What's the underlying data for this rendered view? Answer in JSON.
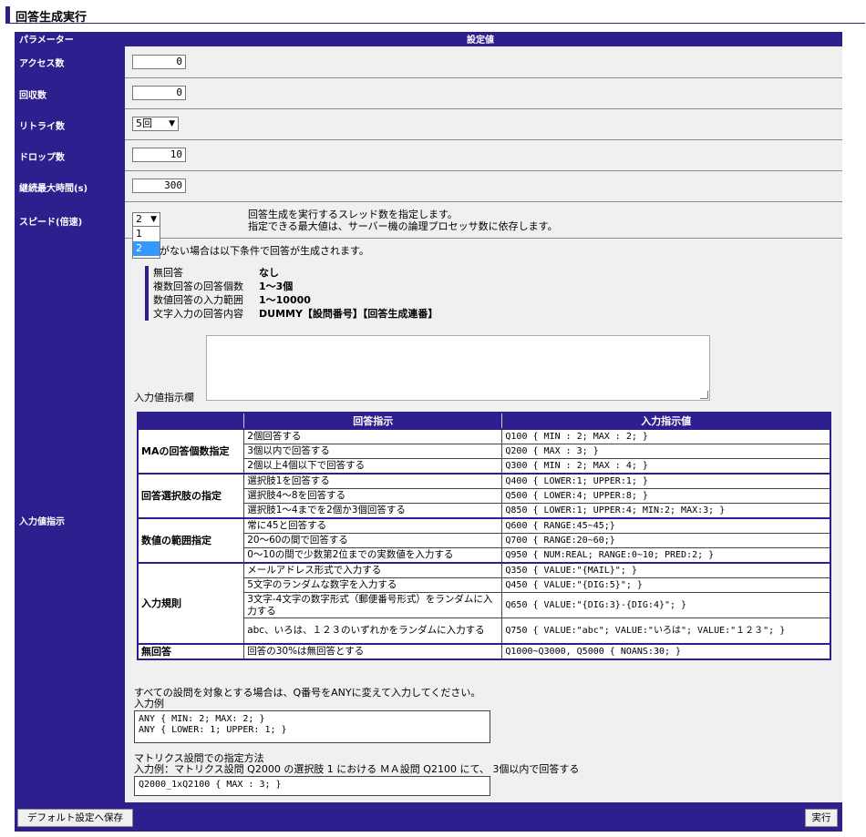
{
  "page_title": "回答生成実行",
  "header": {
    "param": "パラメーター",
    "value": "設定値"
  },
  "rows": {
    "access": {
      "label": "アクセス数",
      "value": "0"
    },
    "collect": {
      "label": "回収数",
      "value": "0"
    },
    "retry": {
      "label": "リトライ数",
      "value": "5回"
    },
    "drop": {
      "label": "ドロップ数",
      "value": "10"
    },
    "duration": {
      "label": "継続最大時間(s)",
      "value": "300"
    },
    "speed": {
      "label": "スピード(倍速)",
      "value": "2",
      "options": [
        "1",
        "2"
      ],
      "hint1": "回答生成を実行するスレッド数を指定します。",
      "hint2": "指定できる最大値は、サーバー機の論理プロセッサ数に依存します。"
    },
    "input": {
      "label": "入力値指示",
      "intro": "がない場合は以下条件で回答が生成されます。",
      "conditions": [
        {
          "k": "無回答",
          "v": "なし"
        },
        {
          "k": "複数回答の回答個数",
          "v": "1～3個"
        },
        {
          "k": "数値回答の入力範囲",
          "v": "1～10000"
        },
        {
          "k": "文字入力の回答内容",
          "v": "DUMMY【設問番号】【回答生成連番】"
        }
      ],
      "textarea_label": "入力値指示欄",
      "table": {
        "headers": [
          "",
          "回答指示",
          "入力指示値"
        ],
        "groups": [
          {
            "cat": "MAの回答個数指定",
            "rows": [
              [
                "2個回答する",
                "Q100 { MIN : 2; MAX : 2; }"
              ],
              [
                "3個以内で回答する",
                "Q200 { MAX : 3; }"
              ],
              [
                "2個以上4個以下で回答する",
                "Q300 { MIN : 2; MAX : 4; }"
              ]
            ]
          },
          {
            "cat": "回答選択肢の指定",
            "rows": [
              [
                "選択肢1を回答する",
                "Q400 { LOWER:1; UPPER:1; }"
              ],
              [
                "選択肢4～8を回答する",
                "Q500 { LOWER:4; UPPER:8; }"
              ],
              [
                "選択肢1～4までを2個か3個回答する",
                "Q850 { LOWER:1; UPPER:4; MIN:2; MAX:3; }"
              ]
            ]
          },
          {
            "cat": "数値の範囲指定",
            "rows": [
              [
                "常に45と回答する",
                "Q600 { RANGE:45~45;}"
              ],
              [
                "20～60の間で回答する",
                "Q700 { RANGE:20~60;}"
              ],
              [
                "0～10の間で少数第2位までの実数値を入力する",
                "Q950 { NUM:REAL; RANGE:0~10; PRED:2; }"
              ]
            ]
          },
          {
            "cat": "入力規則",
            "rows": [
              [
                "メールアドレス形式で入力する",
                "Q350 { VALUE:\"{MAIL}\"; }"
              ],
              [
                "5文字のランダムな数字を入力する",
                "Q450 { VALUE:\"{DIG:5}\"; }"
              ],
              [
                "3文字-4文字の数字形式（郵便番号形式）をランダムに入力する",
                "Q650 { VALUE:\"{DIG:3}-{DIG:4}\"; }"
              ],
              [
                "abc、いろは、１２３のいずれかをランダムに入力する",
                "Q750 { VALUE:\"abc\"; VALUE:\"いろは\"; VALUE:\"１２３\"; }"
              ]
            ]
          },
          {
            "cat": "無回答",
            "rows": [
              [
                "回答の30%は無回答とする",
                "Q1000~Q3000, Q5000 { NOANS:30; }"
              ]
            ]
          }
        ]
      },
      "any_note": "すべての設問を対象とする場合は、Q番号をANYに変えて入力してください。",
      "any_example_label": "入力例",
      "any_example_1": "ANY { MIN: 2; MAX: 2; }",
      "any_example_2": "ANY { LOWER: 1; UPPER: 1; }",
      "matrix_title": "マトリクス設問での指定方法",
      "matrix_example": "入力例：マトリクス設問 Q2000 の選択肢 1 における ＭＡ設問 Q2100 にて、 3個以内で回答する",
      "matrix_code": "Q2000_1xQ2100 { MAX : 3; }"
    }
  },
  "buttons": {
    "save_default": "デフォルト設定へ保存",
    "run": "実行"
  }
}
